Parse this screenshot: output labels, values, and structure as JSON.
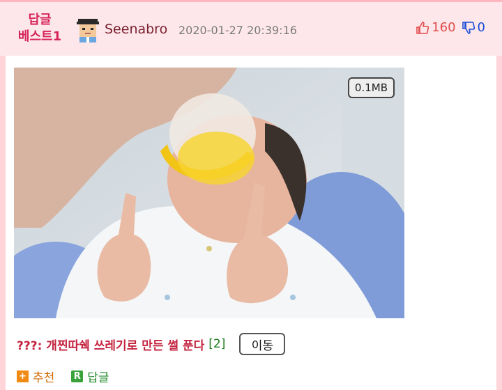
{
  "post": {
    "badge_line1": "답글",
    "badge_line2": "베스트1",
    "username": "Seenabro",
    "timestamp": "2020-01-27 20:39:16",
    "upvotes": "160",
    "downvotes": "0",
    "image_size": "0.1MB",
    "title": "???: 개찐따쉑 쓰레기로 만든 썰 푼다",
    "reply_count": "[2]",
    "move_label": "이동",
    "recommend_label": "추천",
    "reply_label": "답글",
    "recommend_icon_letter": "+",
    "reply_icon_letter": "R"
  },
  "icons": {
    "thumbs_up": "thumbs-up-icon",
    "thumbs_down": "thumbs-down-icon",
    "avatar": "pixel-avatar"
  },
  "colors": {
    "page_bg": "#ffd5da",
    "header_bg": "#fde7ea",
    "badge": "#d6245a",
    "title": "#c4243f",
    "up": "#e24a4a",
    "down": "#1a4bd6"
  }
}
